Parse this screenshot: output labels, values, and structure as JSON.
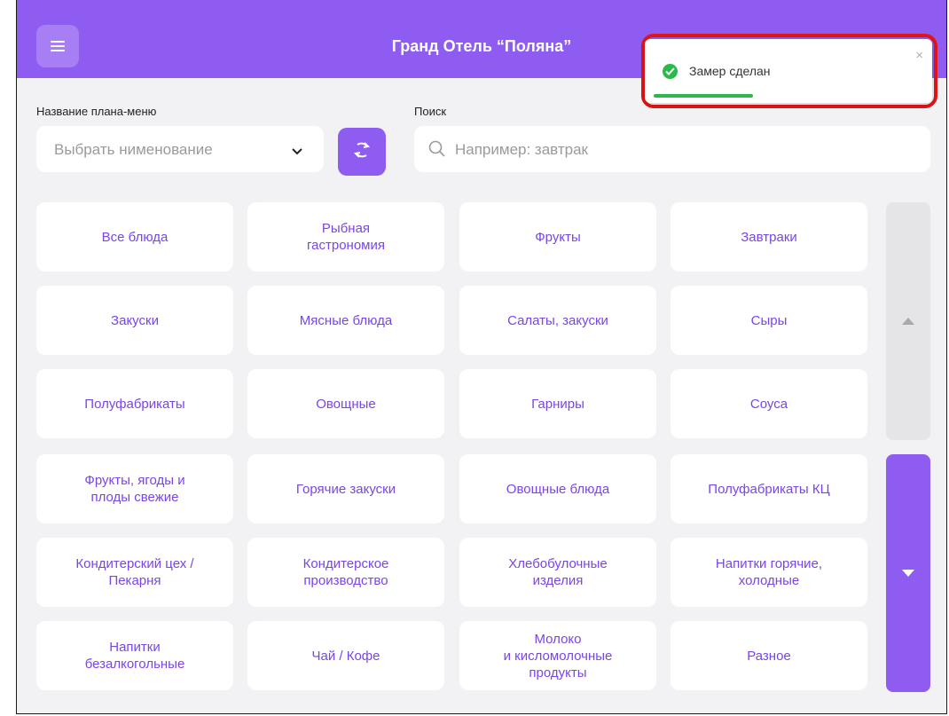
{
  "header": {
    "title": "Гранд Отель “Поляна”",
    "menu_icon": "hamburger-icon"
  },
  "toast": {
    "message": "Замер сделан",
    "close_glyph": "×",
    "icon": "check-circle-icon",
    "progress_fraction": 0.35
  },
  "menu_plan": {
    "label": "Название плана-меню",
    "value": "Выбрать нименование",
    "chevron_icon": "chevron-down-icon",
    "refresh_icon": "refresh-icon"
  },
  "search": {
    "label": "Поиск",
    "placeholder": "Например: завтрак",
    "icon": "search-icon"
  },
  "categories": [
    "Все блюда",
    "Рыбная\nгастрономия",
    "Фрукты",
    "Завтраки",
    "Закуски",
    "Мясные блюда",
    "Салаты, закуски",
    "Сыры",
    "Полуфабрикаты",
    "Овощные",
    "Гарниры",
    "Соуса",
    "Фрукты, ягоды и\nплоды свежие",
    "Горячие закуски",
    "Овощные блюда",
    "Полуфабрикаты КЦ",
    "Кондитерский цех /\nПекарня",
    "Кондитерское\nпроизводство",
    "Хлебобулочные\nизделия",
    "Напитки горячие,\nхолодные",
    "Напитки\nбезалкогольные",
    "Чай / Кофе",
    "Молоко\nи кисломолочные\nпродукты",
    "Разное"
  ],
  "scroll": {
    "up_icon": "triangle-up-icon",
    "down_icon": "triangle-down-icon"
  },
  "colors": {
    "accent": "#8e5cf0",
    "text_accent": "#7a45e8",
    "success": "#2db84d",
    "highlight": "#e01515"
  }
}
